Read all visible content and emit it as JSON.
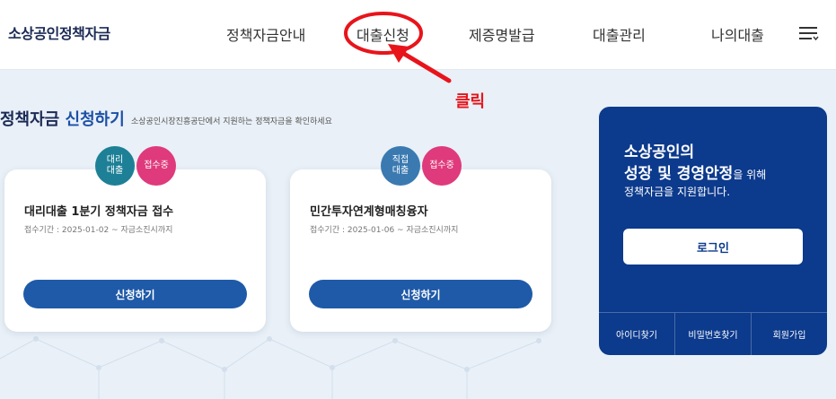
{
  "header": {
    "logo": "소상공인정책자금",
    "nav": [
      "정책자금안내",
      "대출신청",
      "제증명발급",
      "대출관리",
      "나의대출"
    ]
  },
  "annotation": {
    "label": "클릭",
    "color": "#e8141b"
  },
  "section": {
    "title_part1": "정책자금",
    "title_part2": "신청하기",
    "subtitle": "소상공인시장진흥공단에서 지원하는 정책자금을 확인하세요"
  },
  "cards": [
    {
      "badge_type": [
        "대리",
        "대출"
      ],
      "badge_status": "접수중",
      "title": "대리대출 1분기 정책자금 접수",
      "period": "접수기간 : 2025-01-02 ~ 자금소진시까지",
      "button": "신청하기"
    },
    {
      "badge_type": [
        "직접",
        "대출"
      ],
      "badge_status": "접수중",
      "title": "민간투자연계형매칭융자",
      "period": "접수기간 : 2025-01-06 ~ 자금소진시까지",
      "button": "신청하기"
    }
  ],
  "login_panel": {
    "line1": "소상공인의",
    "line2": "성장 및 경영안정",
    "line2_suffix": "을 위해",
    "line3": "정책자금을 지원합니다.",
    "login_button": "로그인",
    "links": [
      "아이디찾기",
      "비밀번호찾기",
      "회원가입"
    ]
  },
  "colors": {
    "brand_navy": "#0c3a8c",
    "button_blue": "#1f5aa8",
    "badge_pink": "#df3a7b",
    "badge_teal": "#1d8096",
    "badge_steel": "#3a7ab1"
  },
  "icons": [
    "hamburger-menu-icon",
    "arrow-icon"
  ]
}
